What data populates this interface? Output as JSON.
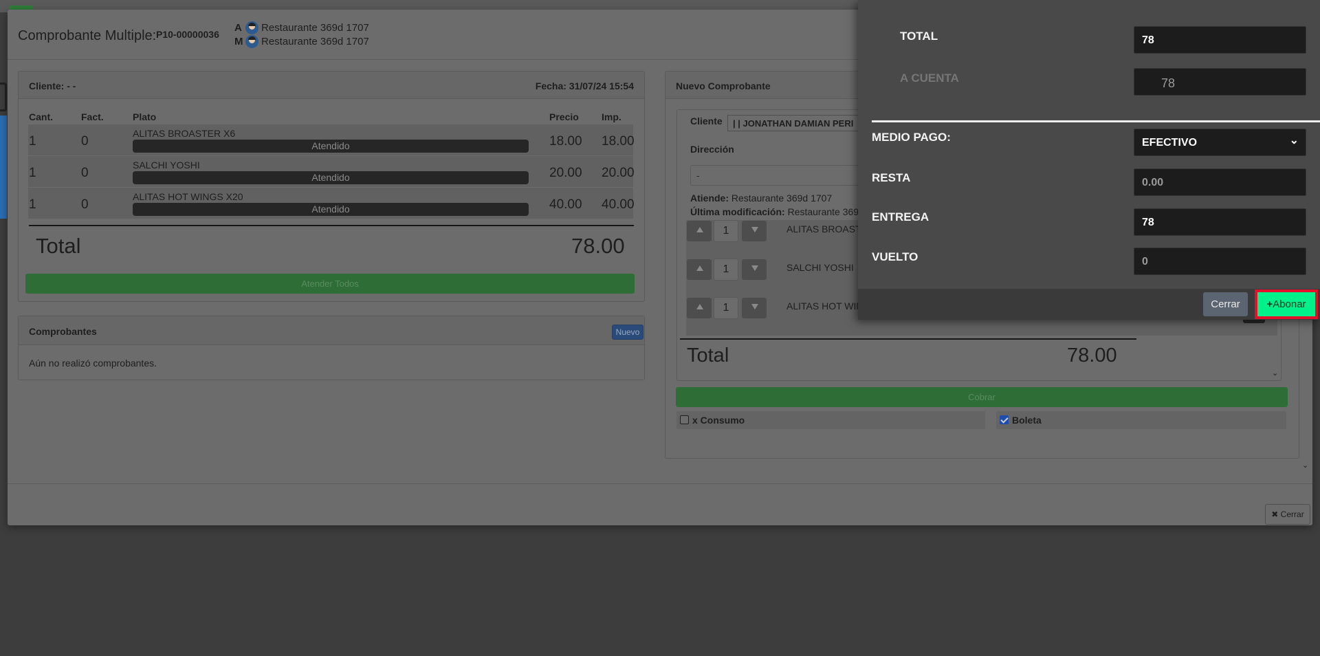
{
  "modal": {
    "title": "Comprobante Multiple:",
    "code": "P10-00000036",
    "users": [
      {
        "letter": "A",
        "name": "Restaurante 369d 1707"
      },
      {
        "letter": "M",
        "name": "Restaurante 369d 1707"
      }
    ],
    "close_label": "✖ Cerrar"
  },
  "order": {
    "client": "Cliente: - -",
    "date": "Fecha: 31/07/24 15:54",
    "columns": [
      "Cant.",
      "Fact.",
      "Plato",
      "Precio",
      "Imp."
    ],
    "rows": [
      {
        "qty": "1",
        "fact": "0",
        "dish": "ALITAS BROASTER X6",
        "status": "Atendido",
        "price": "18.00",
        "amount": "18.00"
      },
      {
        "qty": "1",
        "fact": "0",
        "dish": "SALCHI YOSHI",
        "status": "Atendido",
        "price": "20.00",
        "amount": "20.00"
      },
      {
        "qty": "1",
        "fact": "0",
        "dish": "ALITAS HOT WINGS X20",
        "status": "Atendido",
        "price": "40.00",
        "amount": "40.00"
      }
    ],
    "total_label": "Total",
    "total_value": "78.00",
    "attend_all": "Atender Todos"
  },
  "vouchers": {
    "title": "Comprobantes",
    "new_label": "Nuevo",
    "empty_text": "Aún no realizó comprobantes."
  },
  "new_voucher": {
    "title": "Nuevo Comprobante",
    "client_label": "Cliente",
    "client_value": "| | JONATHAN DAMIAN PERI",
    "address_label": "Dirección",
    "address_value": "-",
    "attends_label": "Atiende:",
    "attends_value": "Restaurante 369d 1707",
    "modified_label": "Última modificación:",
    "modified_value": "Restaurante 369",
    "items": [
      {
        "qty": "1",
        "name": "ALITAS BROASTE"
      },
      {
        "qty": "1",
        "name": "SALCHI YOSHI"
      },
      {
        "qty": "1",
        "name": "ALITAS HOT WING"
      }
    ],
    "total_label": "Total",
    "total_value": "78.00",
    "charge_label": "Cobrar",
    "consumo_label": "x Consumo",
    "consumo_checked": false,
    "boleta_label": "Boleta",
    "boleta_checked": true
  },
  "payment": {
    "total_label": "TOTAL",
    "total_value": "78",
    "account_label": "A CUENTA",
    "account_value": "78",
    "method_label": "MEDIO PAGO:",
    "method_value": "EFECTIVO",
    "remaining_label": "RESTA",
    "remaining_value": "0.00",
    "delivered_label": "ENTREGA",
    "delivered_value": "78",
    "change_label": "VUELTO",
    "change_value": "0",
    "close_label": "Cerrar",
    "submit_label": "Abonar",
    "submit_icon": "+"
  },
  "colors": {
    "abonar_button": "#00f08a",
    "highlight_border": "#e2102a",
    "charge_button": "#2e6e36"
  }
}
